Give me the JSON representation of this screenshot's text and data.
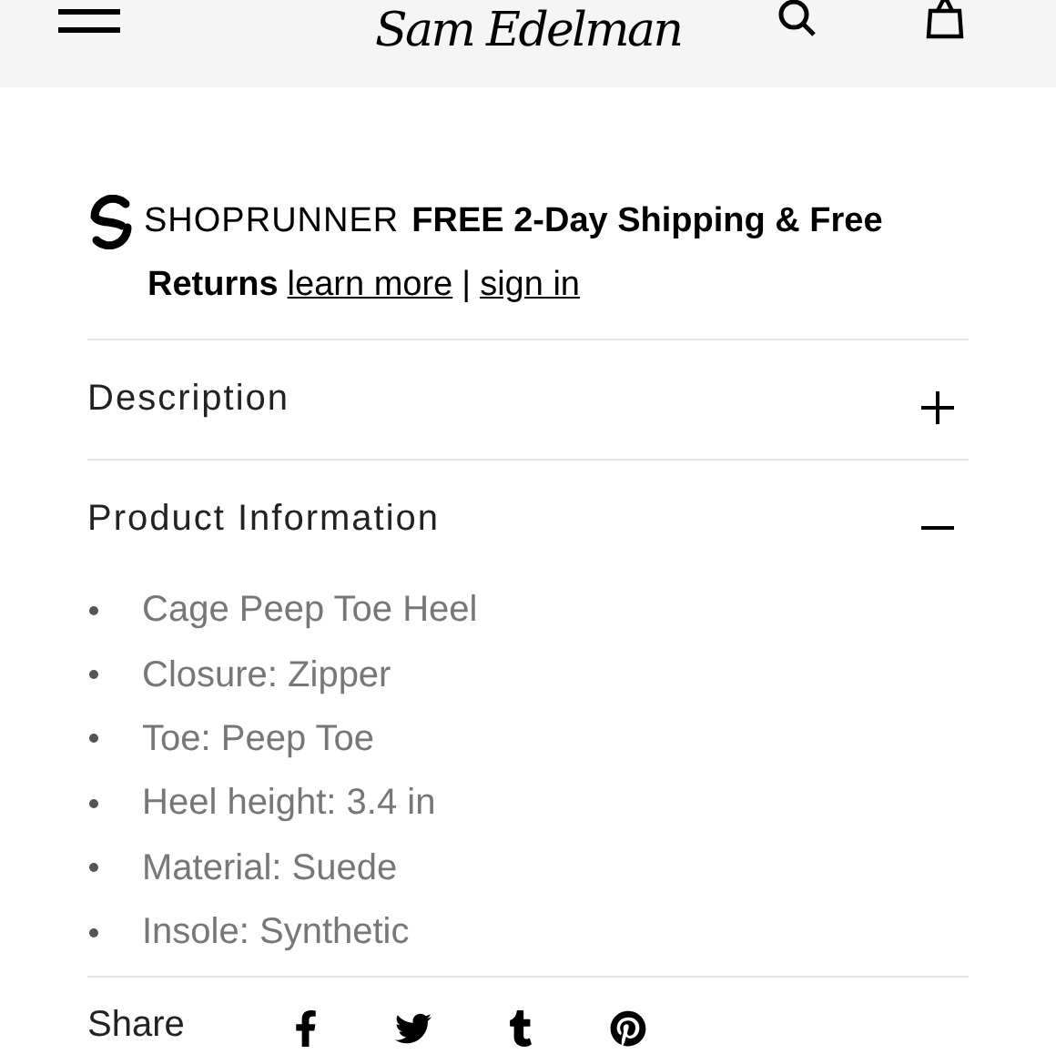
{
  "header": {
    "logo": "Sam Edelman"
  },
  "shoprunner": {
    "brand": "SHOPRUNNER",
    "message": "FREE 2-Day Shipping & Free Returns",
    "links": [
      "learn more",
      "sign in"
    ],
    "separator": "|"
  },
  "sections": [
    {
      "title": "Description",
      "expanded": false
    },
    {
      "title": "Product Information",
      "expanded": true,
      "items": [
        "Cage Peep Toe Heel",
        "Closure: Zipper",
        "Toe: Peep Toe",
        "Heel height: 3.4 in",
        "Material: Suede",
        "Insole: Synthetic"
      ]
    }
  ],
  "share": {
    "label": "Share",
    "networks": [
      {
        "kind": "facebook"
      },
      {
        "kind": "twitter"
      },
      {
        "kind": "tumblr"
      },
      {
        "kind": "pinterest"
      }
    ]
  }
}
